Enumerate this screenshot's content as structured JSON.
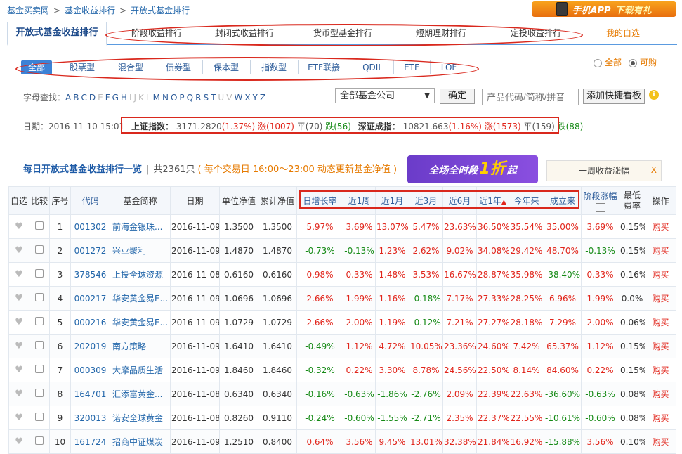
{
  "breadcrumb": [
    "基金买卖网",
    "基金收益排行",
    "开放式基金排行"
  ],
  "app_banner": {
    "text": "手机APP",
    "download": "下载有礼"
  },
  "tabs": [
    {
      "label": "开放式基金收益排行",
      "active": true
    },
    {
      "label": "阶段收益排行"
    },
    {
      "label": "封闭式收益排行"
    },
    {
      "label": "货币型基金排行"
    },
    {
      "label": "短期理财排行"
    },
    {
      "label": "定投收益排行"
    },
    {
      "label": "我的自选"
    }
  ],
  "fund_types": [
    "全部",
    "股票型",
    "混合型",
    "债券型",
    "保本型",
    "指数型",
    "ETF联接",
    "QDII",
    "ETF",
    "LOF"
  ],
  "radios": {
    "all": "全部",
    "buyable": "可购"
  },
  "letter_filter": {
    "label": "字母查找：",
    "letters": [
      "A",
      "B",
      "C",
      "D",
      "E",
      "F",
      "G",
      "H",
      "I",
      "J",
      "K",
      "L",
      "M",
      "N",
      "O",
      "P",
      "Q",
      "R",
      "S",
      "T",
      "U",
      "V",
      "W",
      "X",
      "Y",
      "Z"
    ],
    "dim": [
      "E",
      "I",
      "J",
      "K",
      "L",
      "U",
      "V"
    ]
  },
  "company_select": "全部基金公司",
  "confirm_button": "确定",
  "search_placeholder": "产品代码/简称/拼音",
  "add_board_button": "添加快捷看板",
  "market": {
    "date_label": "日期：",
    "date": "2016-11-10 15:01",
    "sh_label": "上证指数：",
    "sh_value": "3171.2820",
    "sh_change": "(1.37%)",
    "sh_up": "涨(1007)",
    "sh_flat": "平(70)",
    "sh_down": "跌(56)",
    "sz_label": "深证成指：",
    "sz_value": "10821.663",
    "sz_change": "(1.16%)",
    "sz_up": "涨(1573)",
    "sz_flat": "平(159)",
    "sz_down": "跌(88)"
  },
  "heading": {
    "title": "每日开放式基金收益排行一览",
    "count": "共2361只",
    "note": "( 每个交易日 16:00～23:00 动态更新基金净值 )"
  },
  "promo": {
    "pre": "全场全时段",
    "big": "1折",
    "post": "起"
  },
  "week_gain": {
    "label": "一周收益涨幅",
    "close": "X"
  },
  "table": {
    "headers": [
      "自选",
      "比较",
      "序号",
      "代码",
      "基金简称",
      "日期",
      "单位净值",
      "累计净值",
      "日增长率",
      "近1周",
      "近1月",
      "近3月",
      "近6月",
      "近1年",
      "今年来",
      "成立来",
      "阶段涨幅",
      "最低费率",
      "操作"
    ],
    "buy_label": "购买",
    "rows": [
      {
        "n": "1",
        "code": "001302",
        "name": "前海金银珠...",
        "date": "2016-11-09",
        "nav": "1.3500",
        "acc": "1.3500",
        "d": "5.97%",
        "w": "3.69%",
        "m1": "13.07%",
        "m3": "5.47%",
        "m6": "23.63%",
        "y1": "36.50%",
        "ytd": "35.54%",
        "since": "35.00%",
        "stage": "3.69%",
        "fee": "0.15%"
      },
      {
        "n": "2",
        "code": "001272",
        "name": "兴业聚利",
        "date": "2016-11-09",
        "nav": "1.4870",
        "acc": "1.4870",
        "d": "-0.73%",
        "w": "-0.13%",
        "m1": "1.23%",
        "m3": "2.62%",
        "m6": "9.02%",
        "y1": "34.08%",
        "ytd": "29.42%",
        "since": "48.70%",
        "stage": "-0.13%",
        "fee": "0.15%"
      },
      {
        "n": "3",
        "code": "378546",
        "name": "上投全球资源",
        "date": "2016-11-08",
        "nav": "0.6160",
        "acc": "0.6160",
        "d": "0.98%",
        "w": "0.33%",
        "m1": "1.48%",
        "m3": "3.53%",
        "m6": "16.67%",
        "y1": "28.87%",
        "ytd": "35.98%",
        "since": "-38.40%",
        "stage": "0.33%",
        "fee": "0.16%"
      },
      {
        "n": "4",
        "code": "000217",
        "name": "华安黄金易E...",
        "date": "2016-11-09",
        "nav": "1.0696",
        "acc": "1.0696",
        "d": "2.66%",
        "w": "1.99%",
        "m1": "1.16%",
        "m3": "-0.18%",
        "m6": "7.17%",
        "y1": "27.33%",
        "ytd": "28.25%",
        "since": "6.96%",
        "stage": "1.99%",
        "fee": "0.0%"
      },
      {
        "n": "5",
        "code": "000216",
        "name": "华安黄金易E...",
        "date": "2016-11-09",
        "nav": "1.0729",
        "acc": "1.0729",
        "d": "2.66%",
        "w": "2.00%",
        "m1": "1.19%",
        "m3": "-0.12%",
        "m6": "7.21%",
        "y1": "27.27%",
        "ytd": "28.18%",
        "since": "7.29%",
        "stage": "2.00%",
        "fee": "0.06%"
      },
      {
        "n": "6",
        "code": "202019",
        "name": "南方策略",
        "date": "2016-11-09",
        "nav": "1.6410",
        "acc": "1.6410",
        "d": "-0.49%",
        "w": "1.12%",
        "m1": "4.72%",
        "m3": "10.05%",
        "m6": "23.36%",
        "y1": "24.60%",
        "ytd": "7.42%",
        "since": "65.37%",
        "stage": "1.12%",
        "fee": "0.15%"
      },
      {
        "n": "7",
        "code": "000309",
        "name": "大摩品质生活",
        "date": "2016-11-09",
        "nav": "1.8460",
        "acc": "1.8460",
        "d": "-0.32%",
        "w": "0.22%",
        "m1": "3.30%",
        "m3": "8.78%",
        "m6": "24.56%",
        "y1": "22.50%",
        "ytd": "8.14%",
        "since": "84.60%",
        "stage": "0.22%",
        "fee": "0.15%"
      },
      {
        "n": "8",
        "code": "164701",
        "name": "汇添富黄金...",
        "date": "2016-11-08",
        "nav": "0.6340",
        "acc": "0.6340",
        "d": "-0.16%",
        "w": "-0.63%",
        "m1": "-1.86%",
        "m3": "-2.76%",
        "m6": "2.09%",
        "y1": "22.39%",
        "ytd": "22.63%",
        "since": "-36.60%",
        "stage": "-0.63%",
        "fee": "0.08%"
      },
      {
        "n": "9",
        "code": "320013",
        "name": "诺安全球黄金",
        "date": "2016-11-08",
        "nav": "0.8260",
        "acc": "0.9110",
        "d": "-0.24%",
        "w": "-0.60%",
        "m1": "-1.55%",
        "m3": "-2.71%",
        "m6": "2.35%",
        "y1": "22.37%",
        "ytd": "22.55%",
        "since": "-10.61%",
        "stage": "-0.60%",
        "fee": "0.08%"
      },
      {
        "n": "10",
        "code": "161724",
        "name": "招商中证煤炭",
        "date": "2016-11-09",
        "nav": "1.2510",
        "acc": "0.8400",
        "d": "0.64%",
        "w": "3.56%",
        "m1": "9.45%",
        "m3": "13.01%",
        "m6": "32.38%",
        "y1": "21.84%",
        "ytd": "16.92%",
        "since": "-15.88%",
        "stage": "3.56%",
        "fee": "0.10%"
      }
    ]
  }
}
